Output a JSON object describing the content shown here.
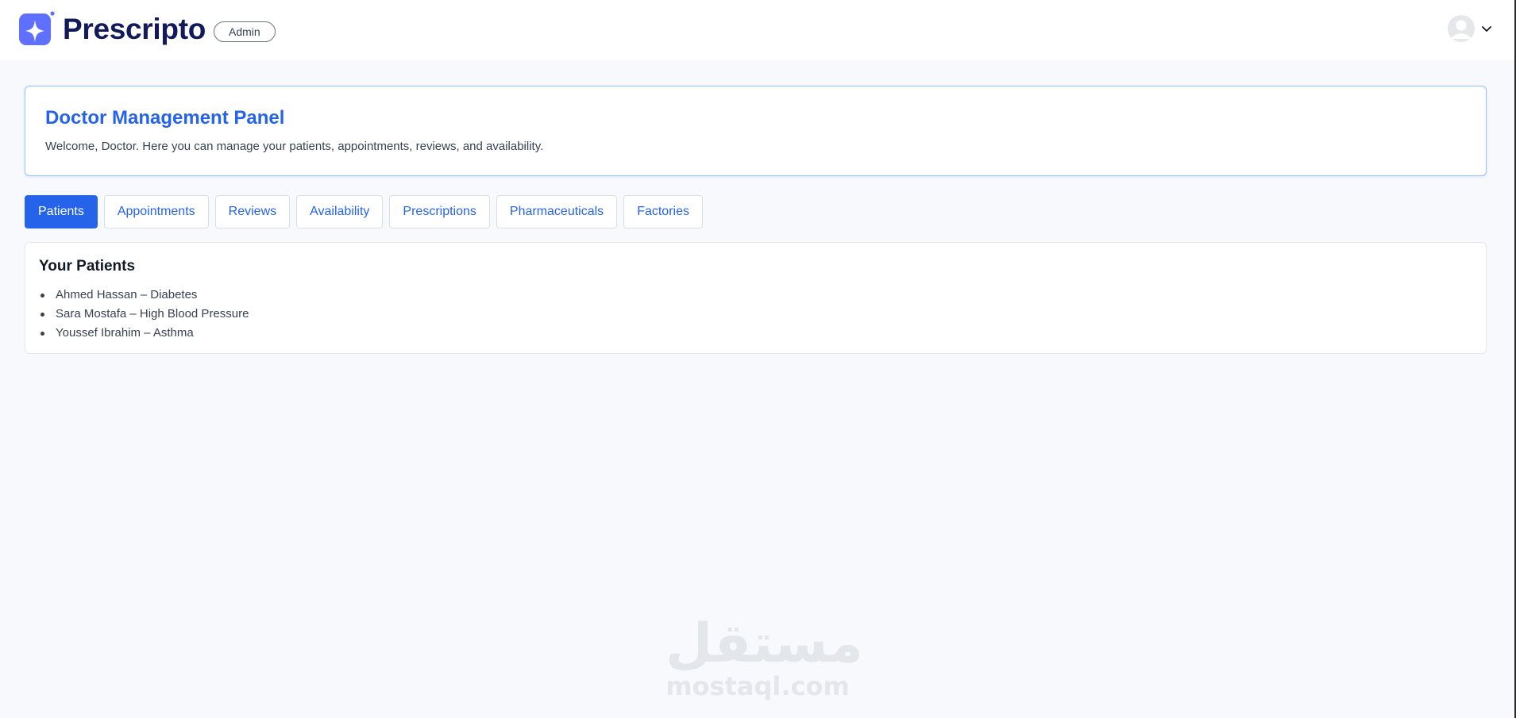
{
  "app": {
    "brand_name": "Prescripto",
    "role_badge": "Admin"
  },
  "header": {
    "user_menu": {
      "avatar_icon": "user-avatar-icon",
      "dropdown_icon": "chevron-down-icon"
    }
  },
  "panel": {
    "title": "Doctor Management Panel",
    "subtitle": "Welcome, Doctor. Here you can manage your patients, appointments, reviews, and availability."
  },
  "tabs": [
    {
      "label": "Patients",
      "active": true
    },
    {
      "label": "Appointments",
      "active": false
    },
    {
      "label": "Reviews",
      "active": false
    },
    {
      "label": "Availability",
      "active": false
    },
    {
      "label": "Prescriptions",
      "active": false
    },
    {
      "label": "Pharmaceuticals",
      "active": false
    },
    {
      "label": "Factories",
      "active": false
    }
  ],
  "patients": {
    "title": "Your Patients",
    "items": [
      "Ahmed Hassan – Diabetes",
      "Sara Mostafa – High Blood Pressure",
      "Youssef Ibrahim – Asthma"
    ]
  },
  "watermark": {
    "arabic": "مستقل",
    "latin": "mostaql.com"
  },
  "colors": {
    "accent": "#2563eb",
    "brand_text": "#131a5b",
    "logo": "#5f6fff",
    "page_bg": "#f7f9fc"
  }
}
